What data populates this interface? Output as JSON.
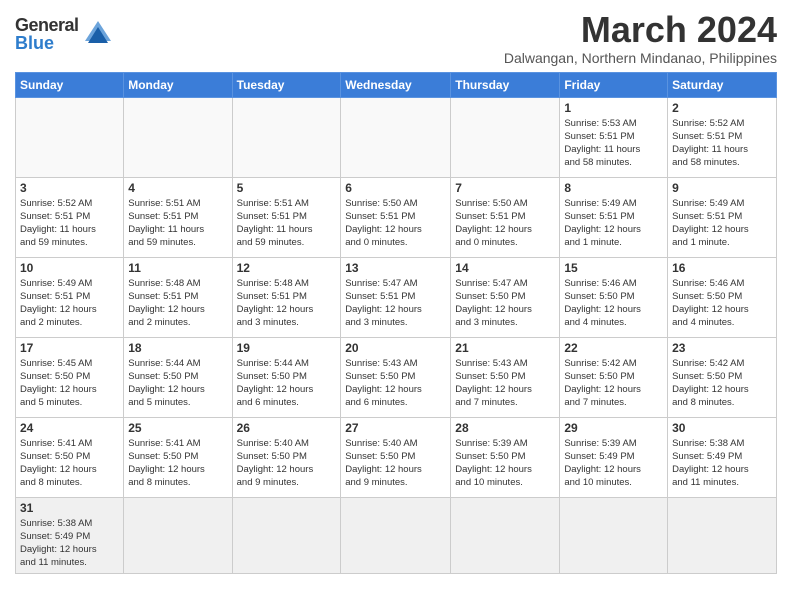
{
  "header": {
    "logo_general": "General",
    "logo_blue": "Blue",
    "title": "March 2024",
    "subtitle": "Dalwangan, Northern Mindanao, Philippines"
  },
  "weekdays": [
    "Sunday",
    "Monday",
    "Tuesday",
    "Wednesday",
    "Thursday",
    "Friday",
    "Saturday"
  ],
  "weeks": [
    [
      {
        "day": "",
        "info": ""
      },
      {
        "day": "",
        "info": ""
      },
      {
        "day": "",
        "info": ""
      },
      {
        "day": "",
        "info": ""
      },
      {
        "day": "",
        "info": ""
      },
      {
        "day": "1",
        "info": "Sunrise: 5:53 AM\nSunset: 5:51 PM\nDaylight: 11 hours\nand 58 minutes."
      },
      {
        "day": "2",
        "info": "Sunrise: 5:52 AM\nSunset: 5:51 PM\nDaylight: 11 hours\nand 58 minutes."
      }
    ],
    [
      {
        "day": "3",
        "info": "Sunrise: 5:52 AM\nSunset: 5:51 PM\nDaylight: 11 hours\nand 59 minutes."
      },
      {
        "day": "4",
        "info": "Sunrise: 5:51 AM\nSunset: 5:51 PM\nDaylight: 11 hours\nand 59 minutes."
      },
      {
        "day": "5",
        "info": "Sunrise: 5:51 AM\nSunset: 5:51 PM\nDaylight: 11 hours\nand 59 minutes."
      },
      {
        "day": "6",
        "info": "Sunrise: 5:50 AM\nSunset: 5:51 PM\nDaylight: 12 hours\nand 0 minutes."
      },
      {
        "day": "7",
        "info": "Sunrise: 5:50 AM\nSunset: 5:51 PM\nDaylight: 12 hours\nand 0 minutes."
      },
      {
        "day": "8",
        "info": "Sunrise: 5:49 AM\nSunset: 5:51 PM\nDaylight: 12 hours\nand 1 minute."
      },
      {
        "day": "9",
        "info": "Sunrise: 5:49 AM\nSunset: 5:51 PM\nDaylight: 12 hours\nand 1 minute."
      }
    ],
    [
      {
        "day": "10",
        "info": "Sunrise: 5:49 AM\nSunset: 5:51 PM\nDaylight: 12 hours\nand 2 minutes."
      },
      {
        "day": "11",
        "info": "Sunrise: 5:48 AM\nSunset: 5:51 PM\nDaylight: 12 hours\nand 2 minutes."
      },
      {
        "day": "12",
        "info": "Sunrise: 5:48 AM\nSunset: 5:51 PM\nDaylight: 12 hours\nand 3 minutes."
      },
      {
        "day": "13",
        "info": "Sunrise: 5:47 AM\nSunset: 5:51 PM\nDaylight: 12 hours\nand 3 minutes."
      },
      {
        "day": "14",
        "info": "Sunrise: 5:47 AM\nSunset: 5:50 PM\nDaylight: 12 hours\nand 3 minutes."
      },
      {
        "day": "15",
        "info": "Sunrise: 5:46 AM\nSunset: 5:50 PM\nDaylight: 12 hours\nand 4 minutes."
      },
      {
        "day": "16",
        "info": "Sunrise: 5:46 AM\nSunset: 5:50 PM\nDaylight: 12 hours\nand 4 minutes."
      }
    ],
    [
      {
        "day": "17",
        "info": "Sunrise: 5:45 AM\nSunset: 5:50 PM\nDaylight: 12 hours\nand 5 minutes."
      },
      {
        "day": "18",
        "info": "Sunrise: 5:44 AM\nSunset: 5:50 PM\nDaylight: 12 hours\nand 5 minutes."
      },
      {
        "day": "19",
        "info": "Sunrise: 5:44 AM\nSunset: 5:50 PM\nDaylight: 12 hours\nand 6 minutes."
      },
      {
        "day": "20",
        "info": "Sunrise: 5:43 AM\nSunset: 5:50 PM\nDaylight: 12 hours\nand 6 minutes."
      },
      {
        "day": "21",
        "info": "Sunrise: 5:43 AM\nSunset: 5:50 PM\nDaylight: 12 hours\nand 7 minutes."
      },
      {
        "day": "22",
        "info": "Sunrise: 5:42 AM\nSunset: 5:50 PM\nDaylight: 12 hours\nand 7 minutes."
      },
      {
        "day": "23",
        "info": "Sunrise: 5:42 AM\nSunset: 5:50 PM\nDaylight: 12 hours\nand 8 minutes."
      }
    ],
    [
      {
        "day": "24",
        "info": "Sunrise: 5:41 AM\nSunset: 5:50 PM\nDaylight: 12 hours\nand 8 minutes."
      },
      {
        "day": "25",
        "info": "Sunrise: 5:41 AM\nSunset: 5:50 PM\nDaylight: 12 hours\nand 8 minutes."
      },
      {
        "day": "26",
        "info": "Sunrise: 5:40 AM\nSunset: 5:50 PM\nDaylight: 12 hours\nand 9 minutes."
      },
      {
        "day": "27",
        "info": "Sunrise: 5:40 AM\nSunset: 5:50 PM\nDaylight: 12 hours\nand 9 minutes."
      },
      {
        "day": "28",
        "info": "Sunrise: 5:39 AM\nSunset: 5:50 PM\nDaylight: 12 hours\nand 10 minutes."
      },
      {
        "day": "29",
        "info": "Sunrise: 5:39 AM\nSunset: 5:49 PM\nDaylight: 12 hours\nand 10 minutes."
      },
      {
        "day": "30",
        "info": "Sunrise: 5:38 AM\nSunset: 5:49 PM\nDaylight: 12 hours\nand 11 minutes."
      }
    ],
    [
      {
        "day": "31",
        "info": "Sunrise: 5:38 AM\nSunset: 5:49 PM\nDaylight: 12 hours\nand 11 minutes."
      },
      {
        "day": "",
        "info": ""
      },
      {
        "day": "",
        "info": ""
      },
      {
        "day": "",
        "info": ""
      },
      {
        "day": "",
        "info": ""
      },
      {
        "day": "",
        "info": ""
      },
      {
        "day": "",
        "info": ""
      }
    ]
  ]
}
